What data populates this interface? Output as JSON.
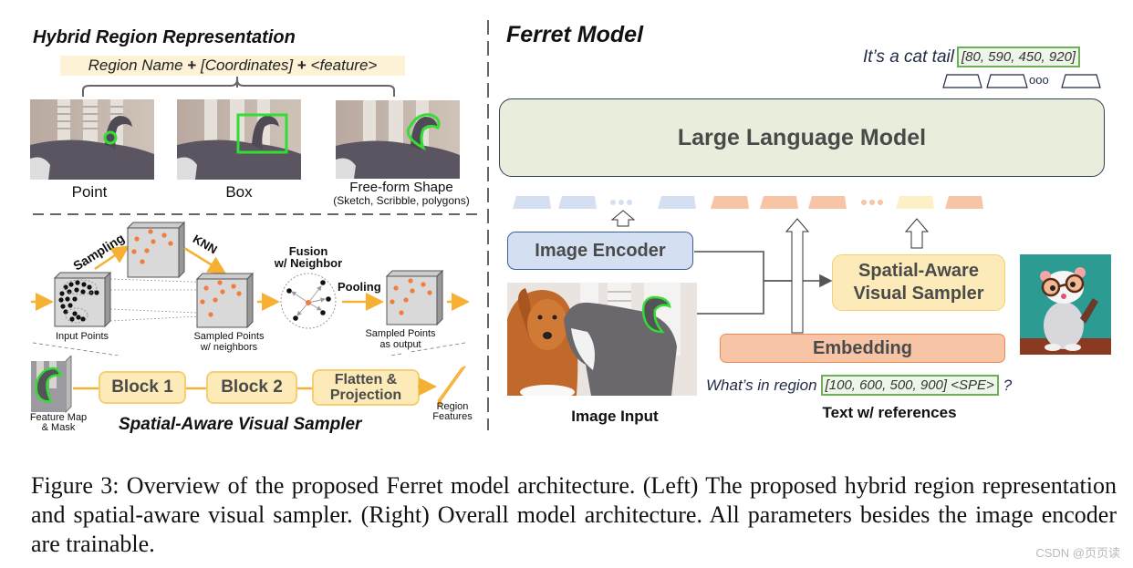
{
  "left_panel": {
    "title": "Hybrid Region Representation",
    "formula": {
      "part1": "Region Name",
      "plus1": "+",
      "part2": "[Coordinates]",
      "plus2": "+",
      "part3": "<feature>"
    },
    "region_types": [
      {
        "label": "Point",
        "sublabel": ""
      },
      {
        "label": "Box",
        "sublabel": ""
      },
      {
        "label": "Free-form Shape",
        "sublabel": "(Sketch, Scribble, polygons)"
      }
    ],
    "sampler_pipeline": {
      "sampling_label": "Sampling",
      "knn_label": "KNN",
      "fusion_label_line1": "Fusion",
      "fusion_label_line2": "w/ Neighbor",
      "pooling_label": "Pooling",
      "input_points_label": "Input Points",
      "sampled_neighbors_line1": "Sampled Points",
      "sampled_neighbors_line2": "w/ neighbors",
      "sampled_output_line1": "Sampled Points",
      "sampled_output_line2": "as output"
    },
    "blocks": {
      "feature_map_line1": "Feature Map",
      "feature_map_line2": "& Mask",
      "block1": "Block 1",
      "block2": "Block 2",
      "flatten_line1": "Flatten &",
      "flatten_line2": "Projection",
      "region_features_line1": "Region",
      "region_features_line2": "Features"
    },
    "subtitle": "Spatial-Aware Visual Sampler"
  },
  "right_panel": {
    "title": "Ferret Model",
    "output_text": "It’s a cat tail",
    "output_coords": "[80, 590, 450, 920]",
    "output_dots": "ooo",
    "llm_label": "Large Language Model",
    "token_dots": "•••",
    "image_encoder_label": "Image Encoder",
    "sampler_line1": "Spatial-Aware",
    "sampler_line2": "Visual Sampler",
    "embedding_label": "Embedding",
    "query_text_prefix": "What’s in region",
    "query_coords": "[100, 600, 500, 900] <SPE>",
    "query_suffix": "?",
    "image_input_label": "Image Input",
    "text_refs_label": "Text w/ references"
  },
  "colors": {
    "highlight_green": "#33dd33",
    "coord_box_border": "#6fae5a",
    "coord_box_bg": "#eef6ea",
    "llm_fill": "#e7efdc",
    "encoder_fill": "#d4e0f2",
    "encoder_border": "#3d5f8f",
    "sampler_fill": "#fcebb8",
    "sampler_border": "#f5cf74",
    "embedding_fill": "#f8c4a6",
    "embedding_border": "#ec8a55",
    "orange_arrow": "#f6b132",
    "orange_dot": "#f37c3b",
    "formula_bg": "#fdf1d6"
  },
  "caption": {
    "text": "Figure 3: Overview of the proposed Ferret model architecture. (Left) The proposed hybrid region representation and spatial-aware visual sampler. (Right) Overall model architecture. All parameters besides the image encoder are trainable."
  },
  "watermark": "CSDN @页页读"
}
